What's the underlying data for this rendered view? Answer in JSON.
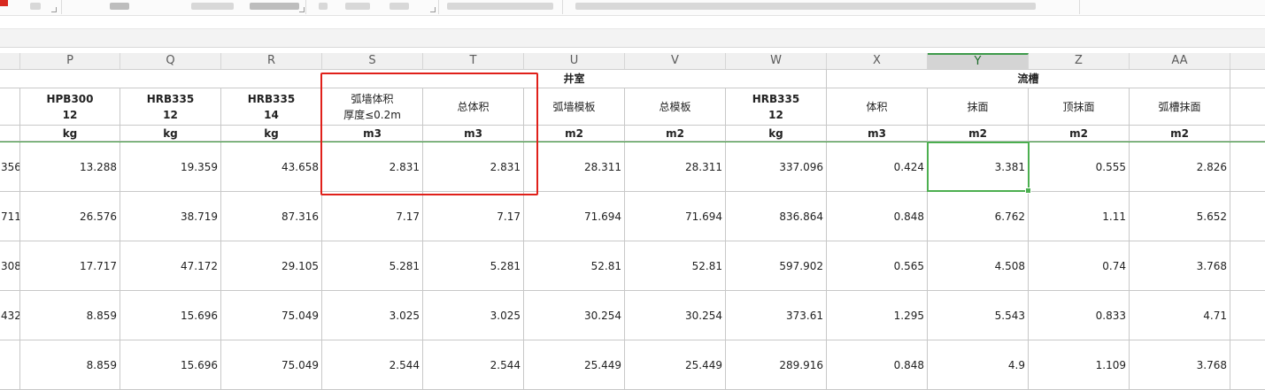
{
  "colors": {
    "selection": "#4caf50",
    "highlight": "#e0201a",
    "unit_rule": "#3a9a3a"
  },
  "column_headers": [
    {
      "id": "O",
      "label": ""
    },
    {
      "id": "P",
      "label": "P"
    },
    {
      "id": "Q",
      "label": "Q"
    },
    {
      "id": "R",
      "label": "R"
    },
    {
      "id": "S",
      "label": "S"
    },
    {
      "id": "T",
      "label": "T"
    },
    {
      "id": "U",
      "label": "U"
    },
    {
      "id": "V",
      "label": "V"
    },
    {
      "id": "W",
      "label": "W"
    },
    {
      "id": "X",
      "label": "X"
    },
    {
      "id": "Y",
      "label": "Y"
    },
    {
      "id": "Z",
      "label": "Z"
    },
    {
      "id": "AA",
      "label": "AA"
    },
    {
      "id": "AB",
      "label": ""
    }
  ],
  "active_column": "Y",
  "group_headers": {
    "shaft": "井室",
    "trough": "流槽"
  },
  "field_names": {
    "p": [
      "HPB300",
      "12"
    ],
    "q": [
      "HRB335",
      "12"
    ],
    "r": [
      "HRB335",
      "14"
    ],
    "s": [
      "弧墙体积",
      "厚度≤0.2m"
    ],
    "t": [
      "总体积"
    ],
    "u": [
      "弧墙模板"
    ],
    "v": [
      "总模板"
    ],
    "w": [
      "HRB335",
      "12"
    ],
    "x": [
      "体积"
    ],
    "y": [
      "抹面"
    ],
    "z": [
      "顶抹面"
    ],
    "aa": [
      "弧槽抹面"
    ]
  },
  "units": [
    "",
    "kg",
    "kg",
    "kg",
    "m3",
    "m3",
    "m2",
    "m2",
    "kg",
    "m3",
    "m2",
    "m2",
    "m2",
    ""
  ],
  "rows": [
    [
      "356",
      "13.288",
      "19.359",
      "43.658",
      "2.831",
      "2.831",
      "28.311",
      "28.311",
      "337.096",
      "0.424",
      "3.381",
      "0.555",
      "2.826",
      ""
    ],
    [
      "711",
      "26.576",
      "38.719",
      "87.316",
      "7.17",
      "7.17",
      "71.694",
      "71.694",
      "836.864",
      "0.848",
      "6.762",
      "1.11",
      "5.652",
      ""
    ],
    [
      "308",
      "17.717",
      "47.172",
      "29.105",
      "5.281",
      "5.281",
      "52.81",
      "52.81",
      "597.902",
      "0.565",
      "4.508",
      "0.74",
      "3.768",
      ""
    ],
    [
      "432",
      "8.859",
      "15.696",
      "75.049",
      "3.025",
      "3.025",
      "30.254",
      "30.254",
      "373.61",
      "1.295",
      "5.543",
      "0.833",
      "4.71",
      ""
    ],
    [
      "",
      "8.859",
      "15.696",
      "75.049",
      "2.544",
      "2.544",
      "25.449",
      "25.449",
      "289.916",
      "0.848",
      "4.9",
      "1.109",
      "3.768",
      ""
    ]
  ],
  "selected_cell": {
    "column": "Y",
    "row": 1,
    "value": "3.381"
  }
}
